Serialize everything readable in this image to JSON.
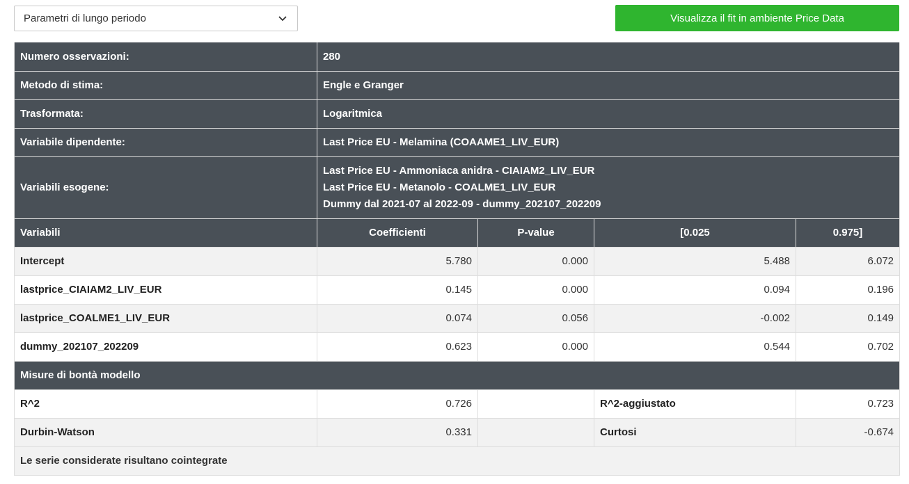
{
  "controls": {
    "select_value": "Parametri di lungo periodo",
    "fit_button": "Visualizza il fit in ambiente Price Data"
  },
  "info": [
    {
      "label": "Numero osservazioni:",
      "value": "280"
    },
    {
      "label": "Metodo di stima:",
      "value": "Engle e Granger"
    },
    {
      "label": "Trasformata:",
      "value": "Logaritmica"
    },
    {
      "label": "Variabile dipendente:",
      "value": "Last Price EU - Melamina (COAAME1_LIV_EUR)"
    }
  ],
  "exog": {
    "label": "Variabili esogene:",
    "values": [
      "Last Price EU - Ammoniaca anidra - CIAIAM2_LIV_EUR",
      "Last Price EU - Metanolo - COALME1_LIV_EUR",
      "Dummy dal 2021-07 al 2022-09 - dummy_202107_202209"
    ]
  },
  "coef_table": {
    "headers": [
      "Variabili",
      "Coefficienti",
      "P-value",
      "[0.025",
      "0.975]"
    ],
    "rows": [
      [
        "Intercept",
        "5.780",
        "0.000",
        "5.488",
        "6.072"
      ],
      [
        "lastprice_CIAIAM2_LIV_EUR",
        "0.145",
        "0.000",
        "0.094",
        "0.196"
      ],
      [
        "lastprice_COALME1_LIV_EUR",
        "0.074",
        "0.056",
        "-0.002",
        "0.149"
      ],
      [
        "dummy_202107_202209",
        "0.623",
        "0.000",
        "0.544",
        "0.702"
      ]
    ]
  },
  "fit": {
    "title": "Misure di bontà modello",
    "rows": [
      {
        "label1": "R^2",
        "value1": "0.726",
        "label2": "R^2-aggiustato",
        "value2": "0.723"
      },
      {
        "label1": "Durbin-Watson",
        "value1": "0.331",
        "label2": "Curtosi",
        "value2": "-0.674"
      }
    ]
  },
  "conclusion": "Le serie considerate risultano cointegrate",
  "colors": {
    "accent_button": "#2fb52f",
    "header_bg": "#495057",
    "row_alt": "#f2f2f2"
  }
}
